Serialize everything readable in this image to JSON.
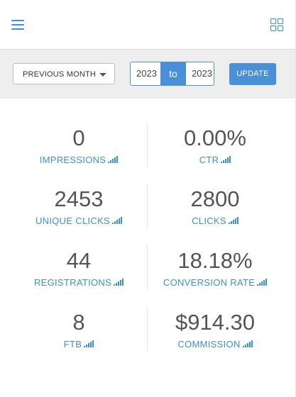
{
  "header": {
    "menu_icon": "hamburger-icon",
    "grid_icon": "grid-icon"
  },
  "filter": {
    "period_label": "PREVIOUS MONTH",
    "date_from": "2023",
    "to_label": "to",
    "date_to": "2023",
    "update_label": "UPDATE"
  },
  "stats": [
    {
      "value": "0",
      "label": "IMPRESSIONS"
    },
    {
      "value": "0.00%",
      "label": "CTR"
    },
    {
      "value": "2453",
      "label": "UNIQUE CLICKS"
    },
    {
      "value": "2800",
      "label": "CLICKS"
    },
    {
      "value": "44",
      "label": "REGISTRATIONS"
    },
    {
      "value": "18.18%",
      "label": "CONVERSION RATE"
    },
    {
      "value": "8",
      "label": "FTB"
    },
    {
      "value": "$914.30",
      "label": "COMMISSION"
    }
  ],
  "colors": {
    "accent": "#4a8fd8",
    "value_text": "#555555",
    "filter_bg": "#eeeeee"
  }
}
